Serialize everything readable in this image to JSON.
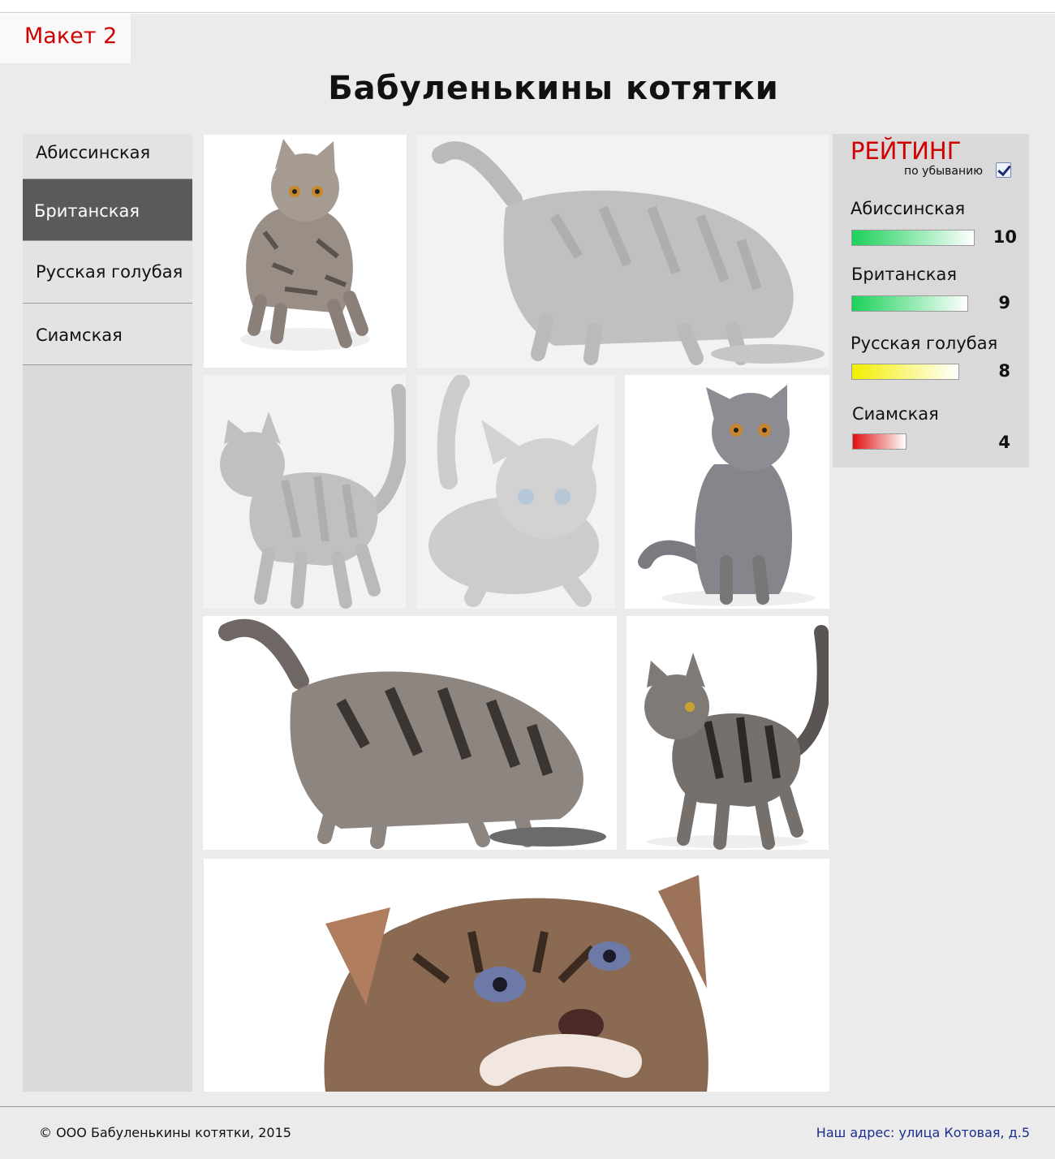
{
  "maket_label": "Макет 2",
  "site_title": "Бабуленькины котятки",
  "nav": {
    "items": [
      {
        "label": "Абиссинская"
      },
      {
        "label": "Британская"
      },
      {
        "label": "Русская голубая"
      },
      {
        "label": "Сиамская"
      }
    ],
    "active": "Британская"
  },
  "rating": {
    "title": "РЕЙТИНГ",
    "sort_label": "по убыванию",
    "sort_checked": true,
    "items": [
      {
        "name": "Абиссинская",
        "value": "10",
        "color": "#1bd15a"
      },
      {
        "name": "Британская",
        "value": "9",
        "color": "#1bd15a"
      },
      {
        "name": "Русская голубая",
        "value": "8",
        "color": "#f2ee00"
      },
      {
        "name": "Сиамская",
        "value": "4",
        "color": "#e01010"
      }
    ]
  },
  "footer": {
    "copyright": "© ООО Бабуленькины котятки, 2015",
    "address": "Наш адрес: улица Котовая, д.5"
  },
  "colors": {
    "accent_red": "#d00000",
    "address_blue": "#1b2f8c",
    "active_nav": "#5a5a5a"
  }
}
